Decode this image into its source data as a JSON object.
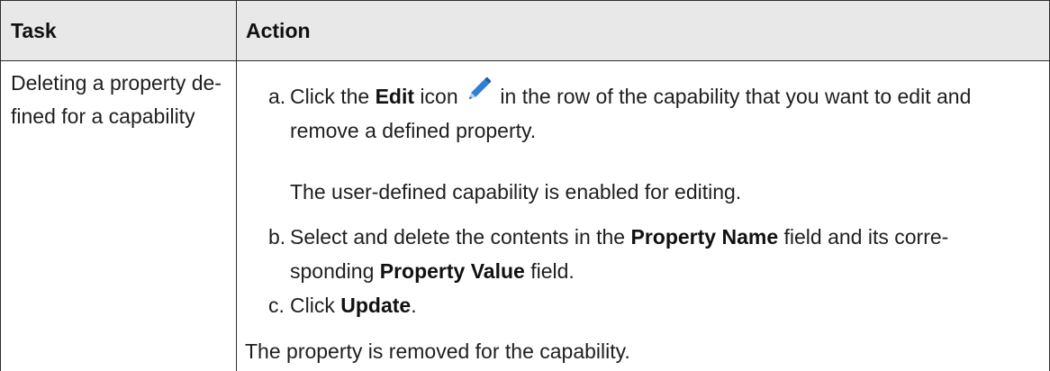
{
  "colors": {
    "header_background": "#e8e8e8",
    "border": "#2f2f2f",
    "text": "#1f1f1f",
    "icon": "#2f7fd2"
  },
  "table": {
    "header": {
      "task": "Task",
      "action": "Action"
    },
    "row": {
      "task_lines": [
        "Deleting a property de-",
        "fined for a capability"
      ],
      "steps": [
        {
          "marker": "a.",
          "line1": {
            "before": "Click the ",
            "bold": "Edit",
            "middle": " icon ",
            "icon": "pencil-edit-icon",
            "after": " in the row of the capability that you want to edit and"
          },
          "line2": "remove a defined property.",
          "note": "The user-defined capability is enabled for editing."
        },
        {
          "marker": "b.",
          "line1": {
            "before": "Select and delete the contents in the ",
            "bold": "Property Name",
            "after": " field and its corre-"
          },
          "line2": {
            "before": "sponding ",
            "bold": "Property Value",
            "after": " field."
          }
        },
        {
          "marker": "c.",
          "line1": {
            "before": "Click ",
            "bold": "Update",
            "after": "."
          }
        }
      ],
      "result": "The property is removed for the capability."
    }
  }
}
